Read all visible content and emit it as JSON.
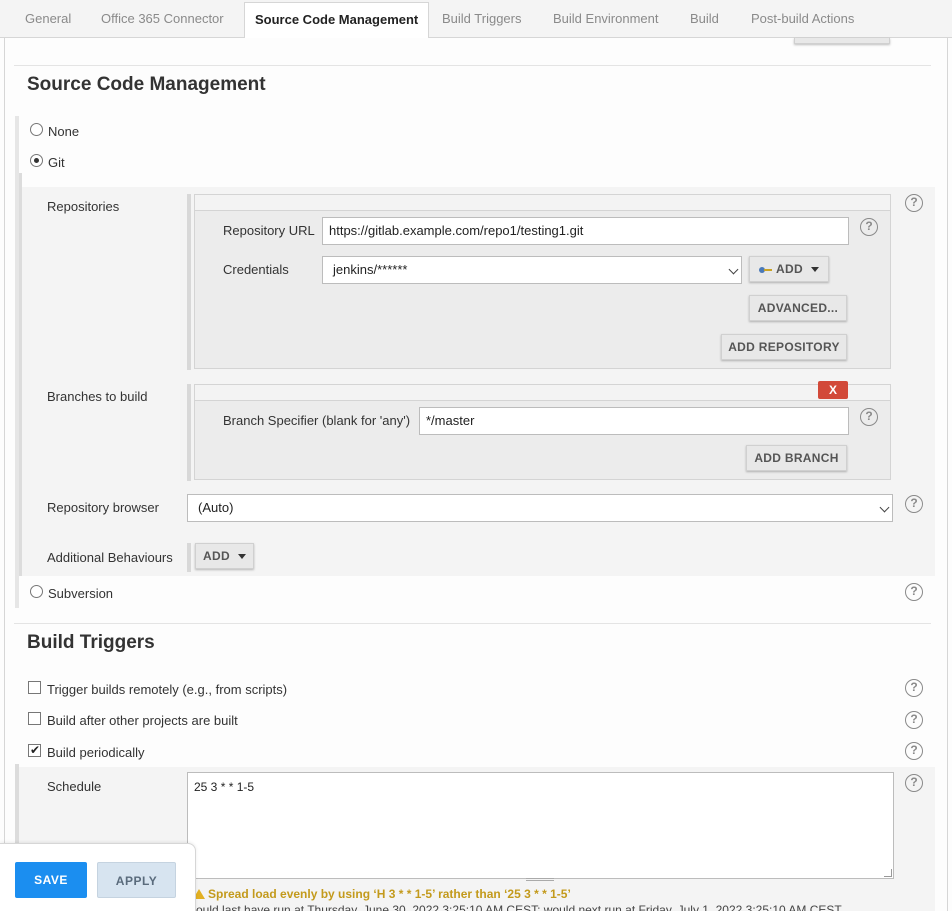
{
  "tabs": [
    {
      "label": "General"
    },
    {
      "label": "Office 365 Connector"
    },
    {
      "label": "Source Code Management"
    },
    {
      "label": "Build Triggers"
    },
    {
      "label": "Build Environment"
    },
    {
      "label": "Build"
    },
    {
      "label": "Post-build Actions"
    }
  ],
  "active_tab": "Source Code Management",
  "scm": {
    "title": "Source Code Management",
    "options": {
      "none": "None",
      "git": "Git",
      "subversion": "Subversion"
    },
    "selected": "Git",
    "repositories_label": "Repositories",
    "repo_url_label": "Repository URL",
    "repo_url_value": "https://gitlab.example.com/repo1/testing1.git",
    "credentials_label": "Credentials",
    "credentials_value": "jenkins/******",
    "add_label": "ADD",
    "advanced_label": "ADVANCED...",
    "add_repository_label": "ADD REPOSITORY",
    "branches_label": "Branches to build",
    "delete_label": "X",
    "branch_specifier_label": "Branch Specifier (blank for 'any')",
    "branch_specifier_value": "*/master",
    "add_branch_label": "ADD BRANCH",
    "repo_browser_label": "Repository browser",
    "repo_browser_value": "(Auto)",
    "additional_behaviours_label": "Additional Behaviours",
    "additional_add_label": "ADD"
  },
  "triggers": {
    "title": "Build Triggers",
    "remote_label": "Trigger builds remotely (e.g., from scripts)",
    "remote_checked": false,
    "after_label": "Build after other projects are built",
    "after_checked": false,
    "periodic_label": "Build periodically",
    "periodic_checked": true,
    "schedule_label": "Schedule",
    "schedule_value": "25 3 * * 1-5",
    "warning": "Spread load evenly by using ‘H 3 * * 1-5’ rather than ‘25 3 * * 1-5’",
    "run_info": "ould last have run at Thursday, June 30, 2022 3:25:10 AM CEST; would next run at Friday, July 1, 2022 3:25:10 AM CEST."
  },
  "footer": {
    "save": "SAVE",
    "apply": "APPLY"
  },
  "help_glyph": "?",
  "colors": {
    "primary": "#1b8ef0",
    "danger": "#d24939",
    "warning": "#c39a1c"
  }
}
